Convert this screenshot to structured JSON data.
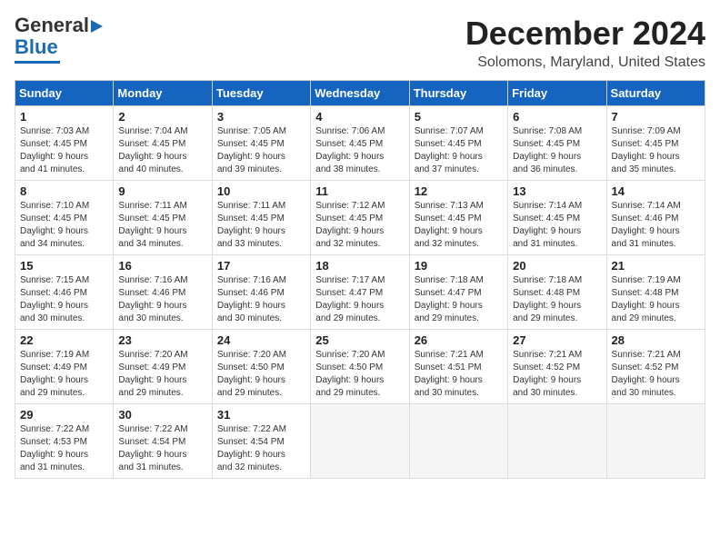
{
  "logo": {
    "line1": "General",
    "line2": "Blue"
  },
  "title": "December 2024",
  "location": "Solomons, Maryland, United States",
  "days_of_week": [
    "Sunday",
    "Monday",
    "Tuesday",
    "Wednesday",
    "Thursday",
    "Friday",
    "Saturday"
  ],
  "weeks": [
    [
      {
        "day": "1",
        "info": "Sunrise: 7:03 AM\nSunset: 4:45 PM\nDaylight: 9 hours\nand 41 minutes."
      },
      {
        "day": "2",
        "info": "Sunrise: 7:04 AM\nSunset: 4:45 PM\nDaylight: 9 hours\nand 40 minutes."
      },
      {
        "day": "3",
        "info": "Sunrise: 7:05 AM\nSunset: 4:45 PM\nDaylight: 9 hours\nand 39 minutes."
      },
      {
        "day": "4",
        "info": "Sunrise: 7:06 AM\nSunset: 4:45 PM\nDaylight: 9 hours\nand 38 minutes."
      },
      {
        "day": "5",
        "info": "Sunrise: 7:07 AM\nSunset: 4:45 PM\nDaylight: 9 hours\nand 37 minutes."
      },
      {
        "day": "6",
        "info": "Sunrise: 7:08 AM\nSunset: 4:45 PM\nDaylight: 9 hours\nand 36 minutes."
      },
      {
        "day": "7",
        "info": "Sunrise: 7:09 AM\nSunset: 4:45 PM\nDaylight: 9 hours\nand 35 minutes."
      }
    ],
    [
      {
        "day": "8",
        "info": "Sunrise: 7:10 AM\nSunset: 4:45 PM\nDaylight: 9 hours\nand 34 minutes."
      },
      {
        "day": "9",
        "info": "Sunrise: 7:11 AM\nSunset: 4:45 PM\nDaylight: 9 hours\nand 34 minutes."
      },
      {
        "day": "10",
        "info": "Sunrise: 7:11 AM\nSunset: 4:45 PM\nDaylight: 9 hours\nand 33 minutes."
      },
      {
        "day": "11",
        "info": "Sunrise: 7:12 AM\nSunset: 4:45 PM\nDaylight: 9 hours\nand 32 minutes."
      },
      {
        "day": "12",
        "info": "Sunrise: 7:13 AM\nSunset: 4:45 PM\nDaylight: 9 hours\nand 32 minutes."
      },
      {
        "day": "13",
        "info": "Sunrise: 7:14 AM\nSunset: 4:45 PM\nDaylight: 9 hours\nand 31 minutes."
      },
      {
        "day": "14",
        "info": "Sunrise: 7:14 AM\nSunset: 4:46 PM\nDaylight: 9 hours\nand 31 minutes."
      }
    ],
    [
      {
        "day": "15",
        "info": "Sunrise: 7:15 AM\nSunset: 4:46 PM\nDaylight: 9 hours\nand 30 minutes."
      },
      {
        "day": "16",
        "info": "Sunrise: 7:16 AM\nSunset: 4:46 PM\nDaylight: 9 hours\nand 30 minutes."
      },
      {
        "day": "17",
        "info": "Sunrise: 7:16 AM\nSunset: 4:46 PM\nDaylight: 9 hours\nand 30 minutes."
      },
      {
        "day": "18",
        "info": "Sunrise: 7:17 AM\nSunset: 4:47 PM\nDaylight: 9 hours\nand 29 minutes."
      },
      {
        "day": "19",
        "info": "Sunrise: 7:18 AM\nSunset: 4:47 PM\nDaylight: 9 hours\nand 29 minutes."
      },
      {
        "day": "20",
        "info": "Sunrise: 7:18 AM\nSunset: 4:48 PM\nDaylight: 9 hours\nand 29 minutes."
      },
      {
        "day": "21",
        "info": "Sunrise: 7:19 AM\nSunset: 4:48 PM\nDaylight: 9 hours\nand 29 minutes."
      }
    ],
    [
      {
        "day": "22",
        "info": "Sunrise: 7:19 AM\nSunset: 4:49 PM\nDaylight: 9 hours\nand 29 minutes."
      },
      {
        "day": "23",
        "info": "Sunrise: 7:20 AM\nSunset: 4:49 PM\nDaylight: 9 hours\nand 29 minutes."
      },
      {
        "day": "24",
        "info": "Sunrise: 7:20 AM\nSunset: 4:50 PM\nDaylight: 9 hours\nand 29 minutes."
      },
      {
        "day": "25",
        "info": "Sunrise: 7:20 AM\nSunset: 4:50 PM\nDaylight: 9 hours\nand 29 minutes."
      },
      {
        "day": "26",
        "info": "Sunrise: 7:21 AM\nSunset: 4:51 PM\nDaylight: 9 hours\nand 30 minutes."
      },
      {
        "day": "27",
        "info": "Sunrise: 7:21 AM\nSunset: 4:52 PM\nDaylight: 9 hours\nand 30 minutes."
      },
      {
        "day": "28",
        "info": "Sunrise: 7:21 AM\nSunset: 4:52 PM\nDaylight: 9 hours\nand 30 minutes."
      }
    ],
    [
      {
        "day": "29",
        "info": "Sunrise: 7:22 AM\nSunset: 4:53 PM\nDaylight: 9 hours\nand 31 minutes."
      },
      {
        "day": "30",
        "info": "Sunrise: 7:22 AM\nSunset: 4:54 PM\nDaylight: 9 hours\nand 31 minutes."
      },
      {
        "day": "31",
        "info": "Sunrise: 7:22 AM\nSunset: 4:54 PM\nDaylight: 9 hours\nand 32 minutes."
      },
      {
        "day": "",
        "info": ""
      },
      {
        "day": "",
        "info": ""
      },
      {
        "day": "",
        "info": ""
      },
      {
        "day": "",
        "info": ""
      }
    ]
  ]
}
